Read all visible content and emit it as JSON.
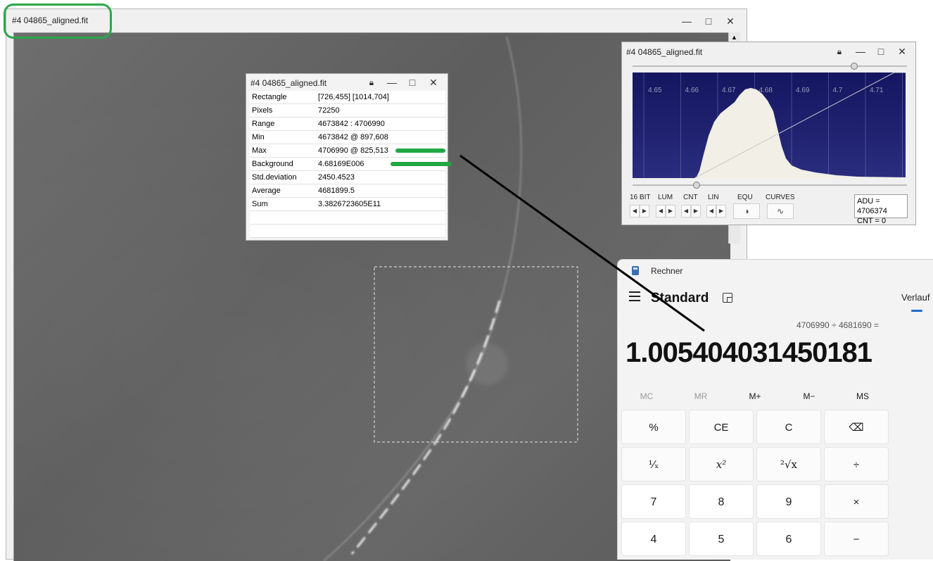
{
  "main_window": {
    "title": "#4 04865_aligned.fit"
  },
  "stats_window": {
    "title": "#4 04865_aligned.fit",
    "rows": [
      {
        "label": "Rectangle",
        "value": "[726,455] [1014,704]"
      },
      {
        "label": "Pixels",
        "value": "72250"
      },
      {
        "label": "Range",
        "value": "4673842 : 4706990"
      },
      {
        "label": "Min",
        "value": "4673842 @ 897,608"
      },
      {
        "label": "Max",
        "value": "4706990 @ 825,513"
      },
      {
        "label": "Background",
        "value": "4.68169E006"
      },
      {
        "label": "Std.deviation",
        "value": "2450.4523"
      },
      {
        "label": "Average",
        "value": "4681899.5"
      },
      {
        "label": "Sum",
        "value": "3.3826723605E11"
      }
    ]
  },
  "histogram_window": {
    "title": "#4 04865_aligned.fit",
    "axis_ticks": [
      "4.65",
      "4.66",
      "4.67",
      "4.68",
      "4.69",
      "4.7",
      "4.71",
      "4."
    ],
    "controls": [
      "16 BIT",
      "LUM",
      "CNT",
      "LIN",
      "EQU",
      "CURVES"
    ],
    "readout_adu": "ADU = 4706374",
    "readout_cnt": "CNT = 0",
    "colors": {
      "plot_bg": "#1c1e6a",
      "histogram_fill": "#f1efe6"
    }
  },
  "calculator": {
    "app_name": "Rechner",
    "mode": "Standard",
    "history_tab": "Verlauf",
    "expression": "4706990 ÷ 4681690 =",
    "result": "1.005404031450181",
    "memory": [
      "MC",
      "MR",
      "M+",
      "M−",
      "MS"
    ],
    "keys": [
      [
        "%",
        "CE",
        "C",
        "⌫"
      ],
      [
        "¹⁄ₓ",
        "x²",
        "²√x",
        "÷"
      ],
      [
        "7",
        "8",
        "9",
        "×"
      ],
      [
        "4",
        "5",
        "6",
        "−"
      ]
    ]
  },
  "annotation_colors": {
    "green": "#21a845",
    "arrow": "#000000"
  }
}
